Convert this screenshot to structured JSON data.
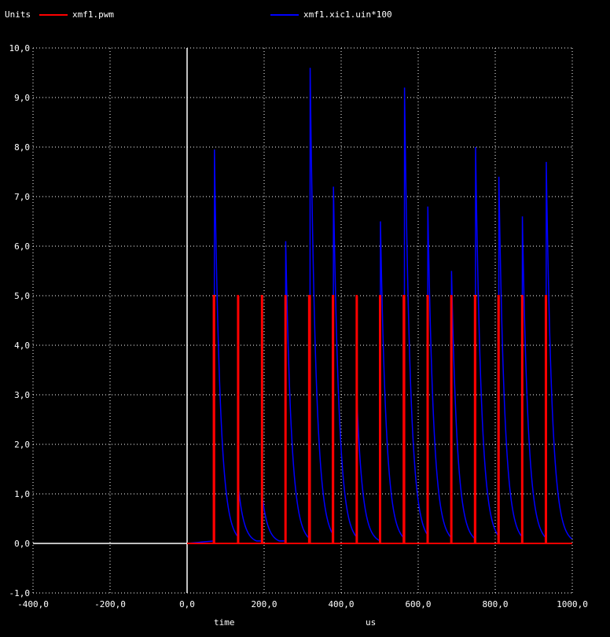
{
  "chart_data": {
    "type": "line",
    "ylabel": "Units",
    "xlabel": "time",
    "xunit": "us",
    "xlim": [
      -400,
      1000
    ],
    "ylim": [
      -1,
      10
    ],
    "xticks": [
      -400,
      -200,
      0,
      200,
      400,
      600,
      800,
      1000
    ],
    "xtick_labels": [
      "-400,0",
      "-200,0",
      "0,0",
      "200,0",
      "400,0",
      "600,0",
      "800,0",
      "1000,0"
    ],
    "yticks": [
      -1,
      0,
      1,
      2,
      3,
      4,
      5,
      6,
      7,
      8,
      9,
      10
    ],
    "ytick_labels": [
      "-1,0",
      "0,0",
      "1,0",
      "2,0",
      "3,0",
      "4,0",
      "5,0",
      "6,0",
      "7,0",
      "8,0",
      "9,0",
      "10,0"
    ],
    "grid": true,
    "legend": "top",
    "series": [
      {
        "name": "xmf1.pwm",
        "color": "#ff0000",
        "pulses": [
          {
            "x": 68.5,
            "w": 2.5
          },
          {
            "x": 131.5,
            "w": 1.0
          },
          {
            "x": 193.5,
            "w": 1.2
          },
          {
            "x": 254.5,
            "w": 1.5
          },
          {
            "x": 316.0,
            "w": 3.5
          },
          {
            "x": 377.5,
            "w": 2.5
          },
          {
            "x": 439.5,
            "w": 1.0
          },
          {
            "x": 500.0,
            "w": 2.0
          },
          {
            "x": 561.5,
            "w": 3.0
          },
          {
            "x": 623.5,
            "w": 1.5
          },
          {
            "x": 685.0,
            "w": 1.5
          },
          {
            "x": 746.5,
            "w": 2.5
          },
          {
            "x": 807.5,
            "w": 2.0
          },
          {
            "x": 869.0,
            "w": 1.5
          },
          {
            "x": 930.5,
            "w": 2.0
          }
        ],
        "low": 0,
        "high": 5
      },
      {
        "name": "xmf1.xic1.uin*100",
        "color": "#0000ff",
        "peaks": [
          {
            "x": 71,
            "y": 7.95
          },
          {
            "x": 132.5,
            "y": 1.2
          },
          {
            "x": 194.5,
            "y": 1.0
          },
          {
            "x": 256,
            "y": 6.1
          },
          {
            "x": 319.5,
            "y": 9.6
          },
          {
            "x": 380,
            "y": 7.2
          },
          {
            "x": 440.5,
            "y": 3.0
          },
          {
            "x": 502,
            "y": 6.5
          },
          {
            "x": 564.5,
            "y": 9.2
          },
          {
            "x": 625,
            "y": 6.8
          },
          {
            "x": 686.5,
            "y": 5.5
          },
          {
            "x": 749,
            "y": 8.0
          },
          {
            "x": 809.5,
            "y": 7.4
          },
          {
            "x": 870.5,
            "y": 6.6
          },
          {
            "x": 932.5,
            "y": 7.7
          }
        ],
        "tau": 15,
        "baseline": 0.05
      }
    ]
  },
  "header": {
    "units_label": "Units",
    "legend_pwm": "xmf1.pwm",
    "legend_uin": "xmf1.xic1.uin*100"
  },
  "footer": {
    "xlabel": "time",
    "xunit": "us"
  }
}
